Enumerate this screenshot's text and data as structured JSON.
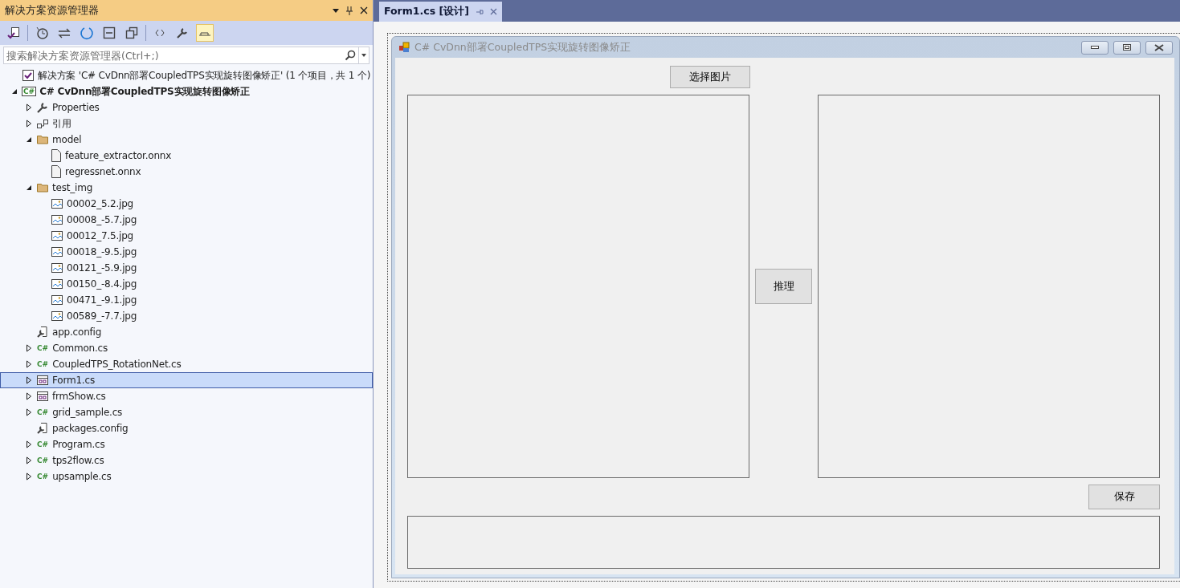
{
  "explorer": {
    "title": "解决方案资源管理器",
    "search": {
      "placeholder": "搜索解决方案资源管理器(Ctrl+;)"
    },
    "tree": [
      {
        "kind": "solution",
        "label": "解决方案 'C# CvDnn部署CoupledTPS实现旋转图像矫正' (1 个项目，共 1 个)",
        "selected": false,
        "children": [
          {
            "kind": "project",
            "badge": "C#",
            "label": "C# CvDnn部署CoupledTPS实现旋转图像矫正",
            "expanded": true,
            "selected": false,
            "children": [
              {
                "kind": "properties",
                "label": "Properties",
                "expanded": false,
                "selected": false
              },
              {
                "kind": "references",
                "label": "引用",
                "expanded": false,
                "selected": false
              },
              {
                "kind": "folder",
                "label": "model",
                "expanded": true,
                "selected": false,
                "children": [
                  {
                    "kind": "file",
                    "label": "feature_extractor.onnx",
                    "selected": false
                  },
                  {
                    "kind": "file",
                    "label": "regressnet.onnx",
                    "selected": false
                  }
                ]
              },
              {
                "kind": "folder",
                "label": "test_img",
                "expanded": true,
                "selected": false,
                "children": [
                  {
                    "kind": "image",
                    "label": "00002_5.2.jpg",
                    "selected": false
                  },
                  {
                    "kind": "image",
                    "label": "00008_-5.7.jpg",
                    "selected": false
                  },
                  {
                    "kind": "image",
                    "label": "00012_7.5.jpg",
                    "selected": false
                  },
                  {
                    "kind": "image",
                    "label": "00018_-9.5.jpg",
                    "selected": false
                  },
                  {
                    "kind": "image",
                    "label": "00121_-5.9.jpg",
                    "selected": false
                  },
                  {
                    "kind": "image",
                    "label": "00150_-8.4.jpg",
                    "selected": false
                  },
                  {
                    "kind": "image",
                    "label": "00471_-9.1.jpg",
                    "selected": false
                  },
                  {
                    "kind": "image",
                    "label": "00589_-7.7.jpg",
                    "selected": false
                  }
                ]
              },
              {
                "kind": "config",
                "label": "app.config",
                "selected": false
              },
              {
                "kind": "csharp",
                "badge": "C#",
                "label": "Common.cs",
                "expanded": false,
                "selected": false
              },
              {
                "kind": "csharp",
                "badge": "C#",
                "label": "CoupledTPS_RotationNet.cs",
                "expanded": false,
                "selected": false
              },
              {
                "kind": "form",
                "label": "Form1.cs",
                "expanded": false,
                "selected": true
              },
              {
                "kind": "form",
                "label": "frmShow.cs",
                "expanded": false,
                "selected": false
              },
              {
                "kind": "csharp",
                "badge": "C#",
                "label": "grid_sample.cs",
                "expanded": false,
                "selected": false
              },
              {
                "kind": "config",
                "label": "packages.config",
                "selected": false
              },
              {
                "kind": "csharp",
                "badge": "C#",
                "label": "Program.cs",
                "expanded": false,
                "selected": false
              },
              {
                "kind": "csharp",
                "badge": "C#",
                "label": "tps2flow.cs",
                "expanded": false,
                "selected": false
              },
              {
                "kind": "csharp",
                "badge": "C#",
                "label": "upsample.cs",
                "expanded": false,
                "selected": false
              }
            ]
          }
        ]
      }
    ]
  },
  "editor": {
    "tabs": [
      {
        "label": "Form1.cs [设计]",
        "selected": true
      }
    ],
    "form": {
      "title": "C# CvDnn部署CoupledTPS实现旋转图像矫正",
      "buttons": {
        "select": "选择图片",
        "infer": "推理",
        "save": "保存"
      }
    }
  }
}
